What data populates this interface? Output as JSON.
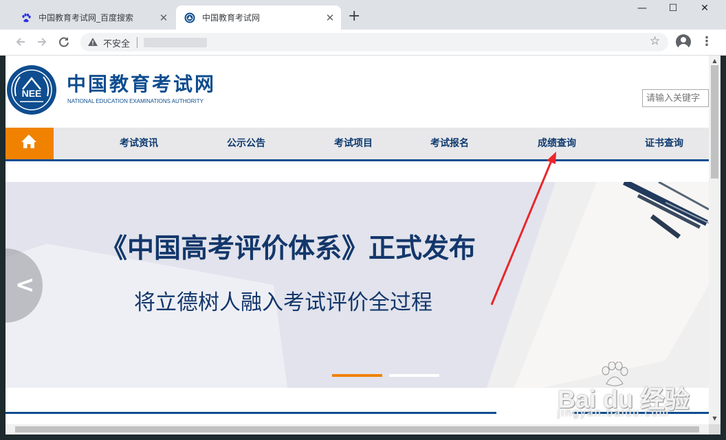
{
  "browser": {
    "tabs": [
      {
        "title": "中国教育考试网_百度搜索",
        "icon": "baidu-paw-icon",
        "active": false
      },
      {
        "title": "中国教育考试网",
        "icon": "neea-seal-icon",
        "active": true
      }
    ],
    "new_tab": "+",
    "window_controls": {
      "minimize": "—",
      "maximize": "☐",
      "close": "✕"
    },
    "security_label": "不安全",
    "bookmark_icon": "☆",
    "menu_icon": "⋮"
  },
  "site": {
    "logo_text": "NEE",
    "name": "中国教育考试网",
    "name_en": "NATIONAL EDUCATION EXAMINATIONS AUTHORITY",
    "search_placeholder": "请输入关键字",
    "nav": {
      "home_icon": "home-icon",
      "items": [
        "考试资讯",
        "公示公告",
        "考试项目",
        "考试报名",
        "成绩查询",
        "证书查询"
      ]
    },
    "banner": {
      "title": "《中国高考评价体系》正式发布",
      "subtitle": "将立德树人融入考试评价全过程",
      "slide_count": 2,
      "active_slide": 1
    }
  },
  "annotation": {
    "arrow_color": "#e8262c",
    "target": "成绩查询"
  },
  "watermark": {
    "text": "Bai du 经验",
    "url": "jingyan.baidu.com"
  },
  "colors": {
    "brand_blue": "#0e4d8f",
    "nav_orange": "#f08200",
    "nav_bg": "#e8e8ea"
  }
}
